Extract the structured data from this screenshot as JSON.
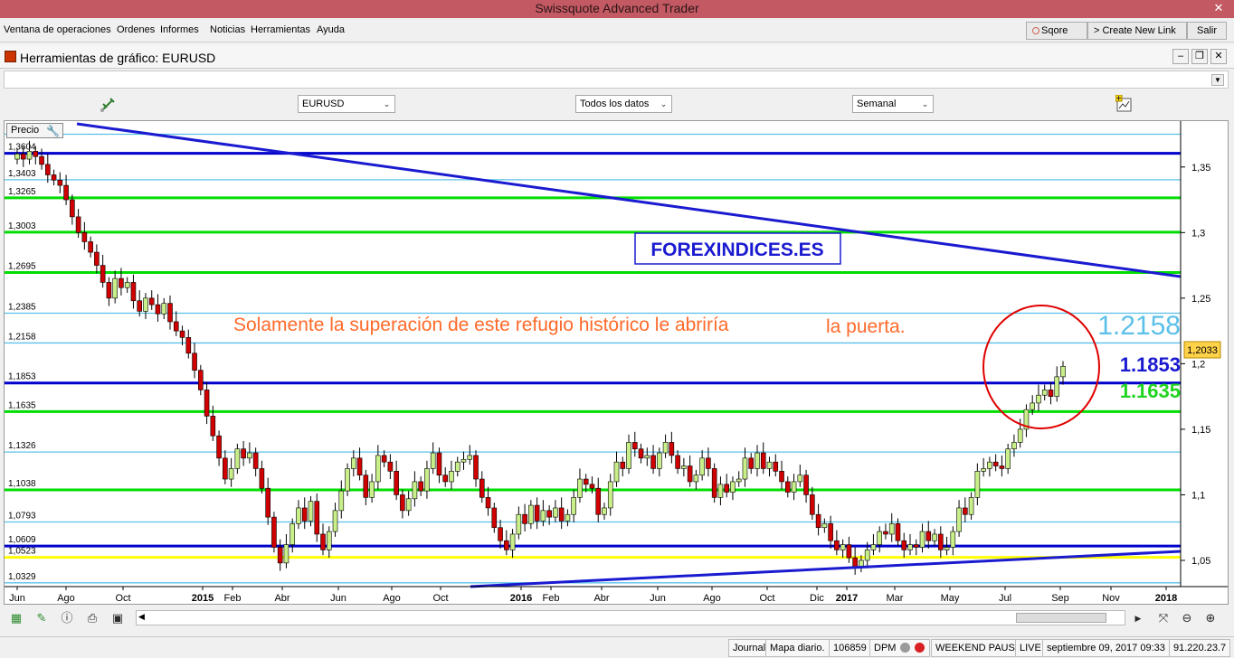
{
  "window": {
    "title": "Swissquote Advanced Trader",
    "close_glyph": "✕"
  },
  "menu": {
    "items": [
      "Ventana de operaciones",
      "Ordenes",
      "Informes",
      "Noticias",
      "Herramientas",
      "Ayuda"
    ],
    "sqore": "Sqore",
    "create_link": "> Create New Link",
    "salir": "Salir"
  },
  "panel": {
    "title": "Herramientas de gráfico: EURUSD"
  },
  "toolbar": {
    "symbol": "EURUSD",
    "range": "Todos los datos",
    "period": "Semanal"
  },
  "chart": {
    "price_button": "Precio",
    "brand": "FOREXINDICES.ES",
    "annotation_1": "Solamente la superación de este refugio histórico le abriría",
    "annotation_2": "la puerta.",
    "level_1_label": "1.2158",
    "level_2_label": "1.1853",
    "level_3_label": "1.1635",
    "current_price": "1,2033",
    "colors": {
      "light_blue": "#5bc0ea",
      "dark_blue": "#0000cc",
      "green": "#00dd00",
      "yellow": "#ffff00",
      "annotation": "#ff6a2a",
      "circle": "#e00000"
    }
  },
  "chart_data": {
    "type": "candlestick",
    "symbol": "EURUSD",
    "period": "Semanal",
    "ylim": [
      1.03,
      1.385
    ],
    "y_ticks": [
      "1,35",
      "1,3",
      "1,25",
      "1,2",
      "1,15",
      "1,1",
      "1,05"
    ],
    "x_ticks": [
      "Jun",
      "Ago",
      "Oct",
      "2015",
      "Feb",
      "Abr",
      "Jun",
      "Ago",
      "Oct",
      "2016",
      "Feb",
      "Abr",
      "Jun",
      "Ago",
      "Oct",
      "Dic",
      "2017",
      "Mar",
      "May",
      "Jul",
      "Sep",
      "Nov",
      "2018"
    ],
    "horizontal_levels": [
      {
        "value": 1.375,
        "label": "",
        "color": "light_blue"
      },
      {
        "value": 1.3604,
        "label": "1,3604",
        "color": "dark_blue"
      },
      {
        "value": 1.3403,
        "label": "1,3403",
        "color": "light_blue"
      },
      {
        "value": 1.3265,
        "label": "1,3265",
        "color": "green"
      },
      {
        "value": 1.3003,
        "label": "1,3003",
        "color": "green"
      },
      {
        "value": 1.2695,
        "label": "1,2695",
        "color": "green"
      },
      {
        "value": 1.2385,
        "label": "1,2385",
        "color": "light_blue"
      },
      {
        "value": 1.2158,
        "label": "1,2158",
        "color": "light_blue"
      },
      {
        "value": 1.1853,
        "label": "1,1853",
        "color": "dark_blue"
      },
      {
        "value": 1.1635,
        "label": "1,1635",
        "color": "green"
      },
      {
        "value": 1.1326,
        "label": "1,1326",
        "color": "light_blue"
      },
      {
        "value": 1.1038,
        "label": "1,1038",
        "color": "green"
      },
      {
        "value": 1.0793,
        "label": "1,0793",
        "color": "light_blue"
      },
      {
        "value": 1.0609,
        "label": "1,0609",
        "color": "dark_blue"
      },
      {
        "value": 1.0523,
        "label": "1,0523",
        "color": "yellow"
      },
      {
        "value": 1.0329,
        "label": "1,0329",
        "color": "light_blue"
      }
    ],
    "closes": [
      1.36,
      1.356,
      1.362,
      1.358,
      1.352,
      1.344,
      1.34,
      1.336,
      1.325,
      1.312,
      1.3,
      1.293,
      1.285,
      1.275,
      1.262,
      1.25,
      1.265,
      1.258,
      1.262,
      1.248,
      1.24,
      1.25,
      1.245,
      1.238,
      1.246,
      1.232,
      1.225,
      1.22,
      1.208,
      1.195,
      1.18,
      1.16,
      1.145,
      1.128,
      1.112,
      1.12,
      1.135,
      1.128,
      1.132,
      1.12,
      1.105,
      1.083,
      1.06,
      1.048,
      1.062,
      1.078,
      1.09,
      1.08,
      1.095,
      1.07,
      1.058,
      1.072,
      1.088,
      1.103,
      1.12,
      1.128,
      1.115,
      1.098,
      1.11,
      1.13,
      1.125,
      1.118,
      1.1,
      1.088,
      1.097,
      1.11,
      1.103,
      1.12,
      1.132,
      1.115,
      1.11,
      1.118,
      1.125,
      1.127,
      1.13,
      1.112,
      1.098,
      1.09,
      1.075,
      1.065,
      1.058,
      1.07,
      1.085,
      1.078,
      1.092,
      1.08,
      1.088,
      1.083,
      1.09,
      1.08,
      1.085,
      1.098,
      1.112,
      1.108,
      1.105,
      1.085,
      1.09,
      1.11,
      1.125,
      1.12,
      1.14,
      1.135,
      1.128,
      1.13,
      1.12,
      1.132,
      1.14,
      1.13,
      1.12,
      1.122,
      1.11,
      1.115,
      1.128,
      1.12,
      1.098,
      1.108,
      1.102,
      1.11,
      1.112,
      1.128,
      1.12,
      1.132,
      1.12,
      1.125,
      1.118,
      1.11,
      1.102,
      1.11,
      1.115,
      1.1,
      1.085,
      1.075,
      1.078,
      1.065,
      1.058,
      1.062,
      1.052,
      1.045,
      1.05,
      1.058,
      1.062,
      1.072,
      1.07,
      1.078,
      1.065,
      1.058,
      1.062,
      1.06,
      1.072,
      1.065,
      1.07,
      1.058,
      1.06,
      1.072,
      1.09,
      1.085,
      1.098,
      1.118,
      1.12,
      1.125,
      1.122,
      1.12,
      1.135,
      1.14,
      1.15,
      1.165,
      1.17,
      1.176,
      1.18,
      1.175,
      1.19,
      1.198
    ]
  },
  "bottom_tools": [
    "chart-icon",
    "draw-icon",
    "info-icon",
    "print-icon",
    "save-icon",
    "scroll-left-icon",
    "scroll-right-icon",
    "fit-icon",
    "zoom-out-icon",
    "zoom-in-icon"
  ],
  "status": {
    "journal": "Journal",
    "map": "Mapa diario.",
    "id": "106859",
    "dpm": "DPM",
    "pause": "WEEKEND PAUSE",
    "live": "LIVE",
    "datetime": "septiembre 09, 2017 09:33",
    "ip": "91.220.23.7"
  }
}
